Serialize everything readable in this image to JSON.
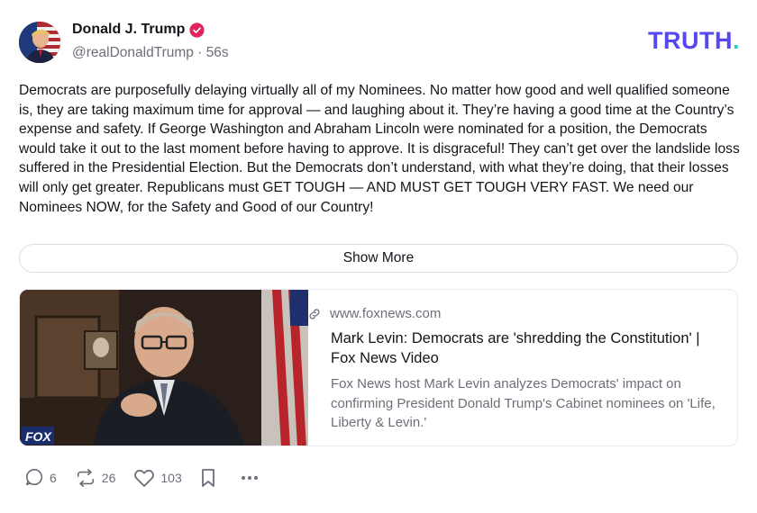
{
  "post": {
    "author_name": "Donald J. Trump",
    "verified_icon": "verified-badge-icon",
    "handle": "@realDonaldTrump",
    "separator": " · ",
    "time_ago": "56s",
    "brand": "TRUTH",
    "brand_dot": ".",
    "text": "Democrats are purposefully delaying virtually all of my Nominees. No matter how good and well qualified someone is, they are taking maximum time for approval — and laughing about it. They’re having a good time at the Country’s expense and safety. If George Washington and Abraham Lincoln were nominated for a position, the Democrats would take it out to the last moment before having to approve. It is disgraceful! They can’t get over the landslide loss suffered in the Presidential Election. But the Democrats don’t understand, with what they’re doing, that their losses will only get greater. Republicans must GET TOUGH — AND MUST GET TOUGH VERY FAST. We need our Nominees NOW, for the Safety and Good of our Country!",
    "show_more_label": "Show More"
  },
  "link_card": {
    "domain": "www.foxnews.com",
    "title": "Mark Levin: Democrats are 'shredding the Constitution' | Fox News Video",
    "description": "Fox News host Mark Levin analyzes Democrats' impact on confirming President Donald Trump's Cabinet nominees on 'Life, Liberty & Levin.'",
    "thumbnail_watermark": "FOX"
  },
  "actions": {
    "replies": "6",
    "retruths": "26",
    "likes": "103"
  },
  "colors": {
    "brand": "#5448ee",
    "brand_accent": "#17d6b9",
    "verified": "#e0245e",
    "muted_text": "#6f6d79"
  }
}
